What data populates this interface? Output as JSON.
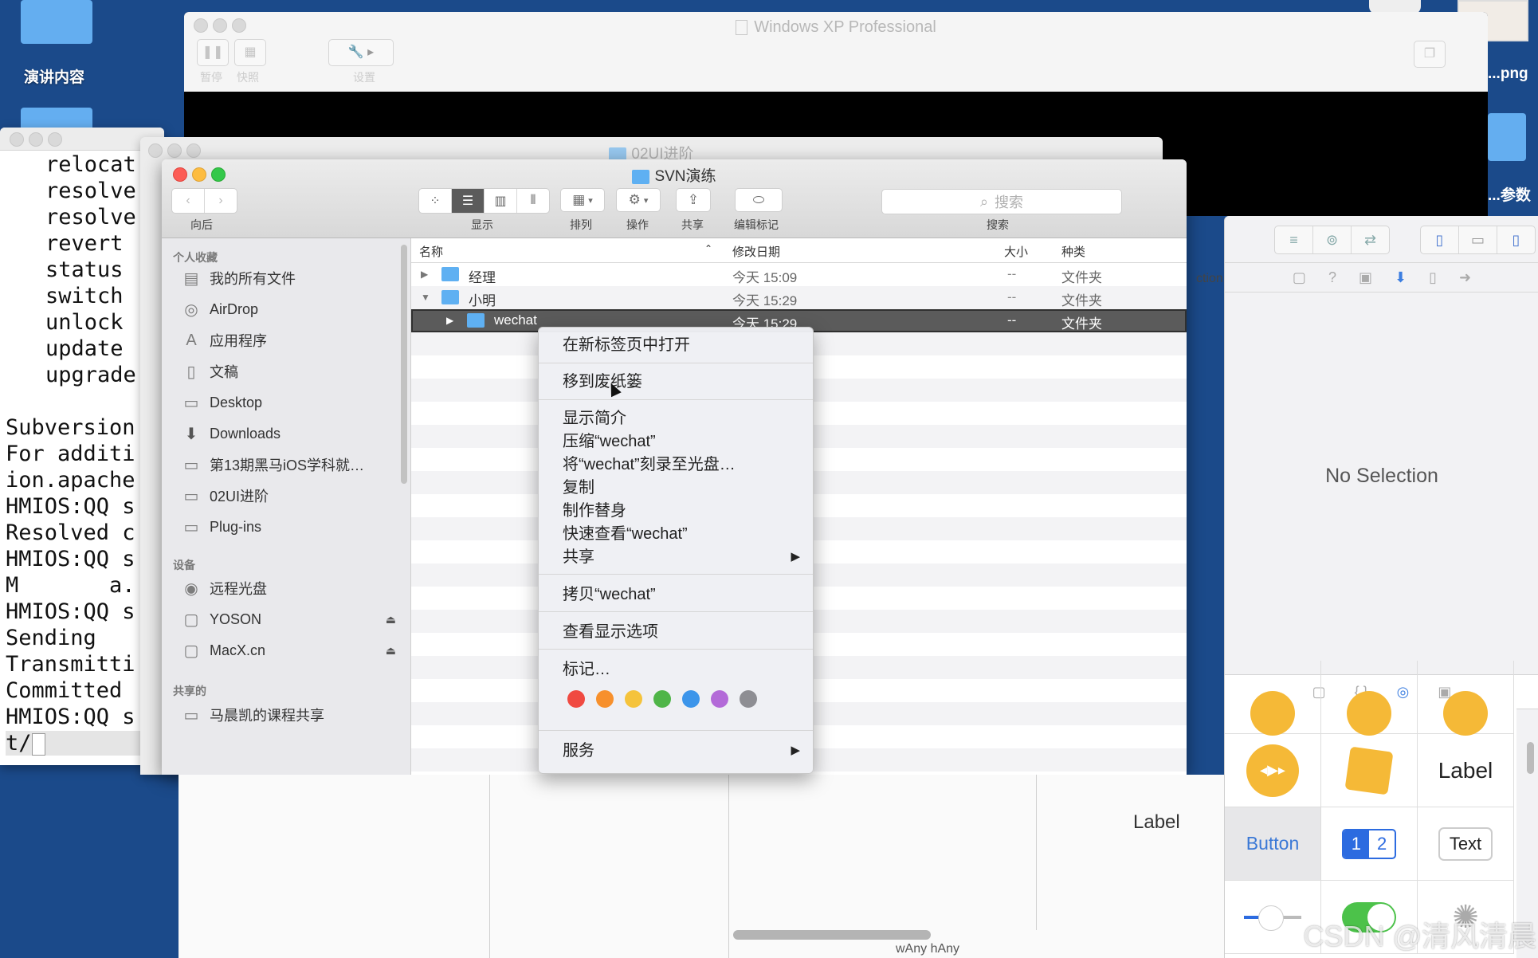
{
  "desktop": {
    "icons": [
      {
        "label": "演讲内容"
      },
      {
        "label": "...png"
      },
      {
        "label": "...参数"
      }
    ]
  },
  "vm_window": {
    "title": "Windows XP Professional",
    "toolbar": [
      {
        "label": "暂停",
        "icon": "pause-icon"
      },
      {
        "label": "快照",
        "icon": "snapshot-icon"
      },
      {
        "label": "设置",
        "icon": "wrench-icon"
      }
    ]
  },
  "terminal": {
    "lines": [
      "relocat",
      "resolve",
      "resolve",
      "revert",
      "status",
      "switch",
      "unlock",
      "update",
      "upgrade",
      "",
      "Subversion",
      "For additi",
      "ion.apache",
      "HMIOS:QQ s",
      "Resolved c",
      "HMIOS:QQ s",
      "M       a.",
      "HMIOS:QQ s",
      "Sending",
      "Transmitti",
      "Committed",
      "HMIOS:QQ s"
    ],
    "prompt": "t/"
  },
  "background_window": {
    "title": "02UI进阶"
  },
  "finder": {
    "title": "SVN演练",
    "toolbar": {
      "back_label": "向后",
      "view_label": "显示",
      "arrange_label": "排列",
      "action_label": "操作",
      "share_label": "共享",
      "tags_label": "编辑标记",
      "search_label": "搜索",
      "search_placeholder": "搜索",
      "view_modes": [
        "icon",
        "list",
        "column",
        "cover-flow"
      ],
      "active_view": "list"
    },
    "sidebar": {
      "sections": [
        {
          "header": "个人收藏",
          "items": [
            {
              "label": "我的所有文件",
              "icon": "all-files-icon"
            },
            {
              "label": "AirDrop",
              "icon": "airdrop-icon"
            },
            {
              "label": "应用程序",
              "icon": "applications-icon"
            },
            {
              "label": "文稿",
              "icon": "documents-icon"
            },
            {
              "label": "Desktop",
              "icon": "desktop-icon"
            },
            {
              "label": "Downloads",
              "icon": "downloads-icon"
            },
            {
              "label": "第13期黑马iOS学科就…",
              "icon": "folder-icon"
            },
            {
              "label": "02UI进阶",
              "icon": "folder-icon"
            },
            {
              "label": "Plug-ins",
              "icon": "folder-icon"
            }
          ]
        },
        {
          "header": "设备",
          "items": [
            {
              "label": "远程光盘",
              "icon": "remote-disc-icon"
            },
            {
              "label": "YOSON",
              "icon": "drive-icon",
              "eject": true
            },
            {
              "label": "MacX.cn",
              "icon": "drive-icon",
              "eject": true
            }
          ]
        },
        {
          "header": "共享的",
          "items": [
            {
              "label": "马晨凯的课程共享",
              "icon": "shared-computer-icon"
            }
          ]
        }
      ]
    },
    "columns": {
      "name": "名称",
      "date": "修改日期",
      "size": "大小",
      "kind": "种类"
    },
    "rows": [
      {
        "name": "经理",
        "date": "今天 15:09",
        "size": "--",
        "kind": "文件夹",
        "expanded": false,
        "level": 0
      },
      {
        "name": "小明",
        "date": "今天 15:29",
        "size": "--",
        "kind": "文件夹",
        "expanded": true,
        "level": 0
      },
      {
        "name": "wechat",
        "date": "今天 15:29",
        "size": "--",
        "kind": "文件夹",
        "expanded": false,
        "level": 1,
        "selected": true
      }
    ]
  },
  "context_menu": {
    "items": [
      {
        "label": "在新标签页中打开"
      },
      {
        "label": "移到废纸篓"
      },
      {
        "label": "显示简介"
      },
      {
        "label": "压缩“wechat”"
      },
      {
        "label": "将“wechat”刻录至光盘…"
      },
      {
        "label": "复制"
      },
      {
        "label": "制作替身"
      },
      {
        "label": "快速查看“wechat”"
      },
      {
        "label": "共享",
        "submenu": true
      },
      {
        "label": "拷贝“wechat”"
      },
      {
        "label": "查看显示选项"
      },
      {
        "label": "标记…"
      },
      {
        "label": "服务",
        "submenu": true
      }
    ],
    "tag_colors": [
      "#f04a41",
      "#f7902c",
      "#f5c33b",
      "#4fb548",
      "#3c95ea",
      "#b36ad8",
      "#8e8e93"
    ]
  },
  "xcode": {
    "canvas_label": "Label",
    "size_class": "wAny hAny",
    "inspector_partial_label": "ction",
    "no_selection": "No Selection",
    "library": {
      "items": [
        {
          "name": "AVKit Player View Controller",
          "type": "media"
        },
        {
          "name": "Object",
          "type": "cube"
        },
        {
          "name": "Label",
          "text": "Label"
        },
        {
          "name": "Button",
          "text": "Button"
        },
        {
          "name": "Segmented Control",
          "segments": [
            "1",
            "2"
          ]
        },
        {
          "name": "Text Field",
          "text": "Text"
        },
        {
          "name": "Slider"
        },
        {
          "name": "Switch"
        },
        {
          "name": "Activity Indicator"
        }
      ]
    }
  },
  "watermark": "CSDN @清风清晨"
}
